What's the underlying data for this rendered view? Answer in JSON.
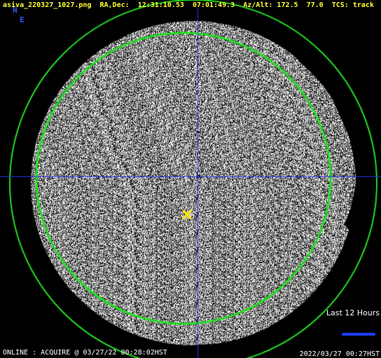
{
  "header": {
    "filename": "asiva_220327_1027.png",
    "radec_label": "RA,Dec:",
    "ra": "12:31:10.53",
    "dec": "07:01:49.3",
    "azalt_label": "Az/Alt:",
    "az": "172.5",
    "alt": "77.0",
    "tcs_label": "TCS:",
    "tcs_state": "track"
  },
  "compass": {
    "north": "N",
    "east": "E"
  },
  "status": {
    "footer_left": "ONLINE : ACQUIRE @ 03/27/22 00:28:02HST"
  },
  "timestamp": {
    "footer_right": "2022/03/27 00:27HST"
  },
  "legend": {
    "label": "Last 12 Hours",
    "color": "#1f3dff"
  },
  "colors": {
    "header_text": "#ffff33",
    "compass": "#3355ff",
    "horizon_circle": "#22dd22",
    "crosshair": "#2233ee",
    "target_marker": "#ffee00"
  },
  "icons": {
    "target": "x-marker-icon"
  }
}
